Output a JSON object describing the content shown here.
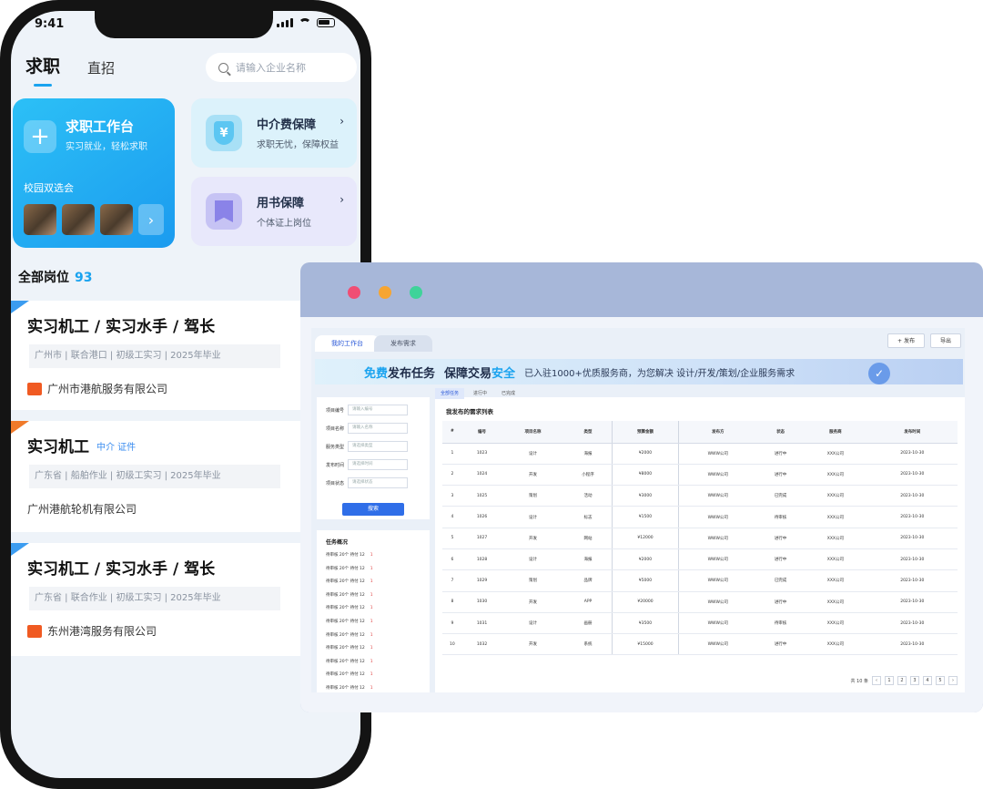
{
  "phone": {
    "status_time": "9:41",
    "tabs": {
      "active": "求职",
      "other": "直招"
    },
    "search_placeholder": "请输入企业名称",
    "main_card": {
      "title": "求职工作台",
      "subtitle": "实习就业，轻松求职",
      "label": "校园双选会",
      "more": "›"
    },
    "side_cards": [
      {
        "title": "中介费保障",
        "arrow": "›",
        "subtitle": "求职无忧，保障权益",
        "icon": "shield-icon"
      },
      {
        "title": "用书保障",
        "arrow": "›",
        "subtitle": "个体证上岗位",
        "icon": "bookmark-icon"
      }
    ],
    "all_positions": {
      "label": "全部岗位",
      "count": "93"
    },
    "jobs": [
      {
        "title": "实习机工 / 实习水手 / 驾长",
        "tag": "",
        "meta": "广州市 | 联合港口 | 初级工实习 | 2025年毕业",
        "company": "广州市港航服务有限公司",
        "corner_color": "#3b9cf0",
        "logo_color": "#f05a22"
      },
      {
        "title": "实习机工",
        "tag": "中介  证件",
        "meta": "广东省 | 船舶作业 | 初级工实习 | 2025年毕业",
        "company": "广州港航轮机有限公司",
        "corner_color": "#f07a2a",
        "logo_color": ""
      },
      {
        "title": "实习机工 / 实习水手 / 驾长",
        "tag": "",
        "meta": "广东省 | 联合作业 | 初级工实习 | 2025年毕业",
        "company": "东州港湾服务有限公司",
        "corner_color": "#3b9cf0",
        "logo_color": "#f05a22"
      }
    ]
  },
  "window": {
    "dot_colors": [
      "#f04e74",
      "#f7a531",
      "#3fd39a"
    ],
    "tabs": [
      "我的工作台",
      "发布需求"
    ],
    "buttons": [
      "+ 发布",
      "导出"
    ],
    "banner": {
      "part1": "免费",
      "part2": "发布任务",
      "part3": "保障交易",
      "part4": "安全",
      "rest": "已入驻1000+优质服务商，为您解决 设计/开发/策划/企业服务需求",
      "check": "✓"
    },
    "filters": [
      {
        "label": "项目编号",
        "placeholder": "请输入编号"
      },
      {
        "label": "项目名称",
        "placeholder": "请输入名称"
      },
      {
        "label": "服务类型",
        "placeholder": "请选择类型"
      },
      {
        "label": "发布时间",
        "placeholder": "请选择时间"
      },
      {
        "label": "项目状态",
        "placeholder": "请选择状态"
      }
    ],
    "search_button": "搜索",
    "stats_title": "任务概况",
    "stats_rows": [
      {
        "text": "待审核 20个  待付 12",
        "badge": "1"
      },
      {
        "text": "待审核 20个  待付 12",
        "badge": "1"
      },
      {
        "text": "待审核 20个  待付 12",
        "badge": "1"
      },
      {
        "text": "待审核 20个  待付 12",
        "badge": "1"
      },
      {
        "text": "待审核 20个  待付 12",
        "badge": "1"
      },
      {
        "text": "待审核 20个  待付 12",
        "badge": "1"
      },
      {
        "text": "待审核 20个  待付 12",
        "badge": "1"
      },
      {
        "text": "待审核 20个  待付 12",
        "badge": "1"
      },
      {
        "text": "待审核 20个  待付 12",
        "badge": "1"
      },
      {
        "text": "待审核 20个  待付 12",
        "badge": "1"
      },
      {
        "text": "待审核 20个  待付 12",
        "badge": "1"
      }
    ],
    "table_tabs": [
      "全部任务",
      "进行中",
      "已完成"
    ],
    "table_title": "我发布的需求列表",
    "columns": [
      "#",
      "编号",
      "项目名称",
      "类型",
      "预算金额",
      "发布方",
      "状态",
      "服务商",
      "发布时间"
    ],
    "rows": [
      [
        "1",
        "1023",
        "设计",
        "海报",
        "¥2000",
        "WWW公司",
        "进行中",
        "XXX公司",
        "2023-10-30"
      ],
      [
        "2",
        "1024",
        "开发",
        "小程序",
        "¥8000",
        "WWW公司",
        "进行中",
        "XXX公司",
        "2023-10-30"
      ],
      [
        "3",
        "1025",
        "策划",
        "活动",
        "¥3000",
        "WWW公司",
        "已完成",
        "XXX公司",
        "2023-10-30"
      ],
      [
        "4",
        "1026",
        "设计",
        "标志",
        "¥1500",
        "WWW公司",
        "待审核",
        "XXX公司",
        "2023-10-30"
      ],
      [
        "5",
        "1027",
        "开发",
        "网站",
        "¥12000",
        "WWW公司",
        "进行中",
        "XXX公司",
        "2023-10-30"
      ],
      [
        "6",
        "1028",
        "设计",
        "海报",
        "¥2000",
        "WWW公司",
        "进行中",
        "XXX公司",
        "2023-10-30"
      ],
      [
        "7",
        "1029",
        "策划",
        "品牌",
        "¥5000",
        "WWW公司",
        "已完成",
        "XXX公司",
        "2023-10-30"
      ],
      [
        "8",
        "1030",
        "开发",
        "APP",
        "¥20000",
        "WWW公司",
        "进行中",
        "XXX公司",
        "2023-10-30"
      ],
      [
        "9",
        "1031",
        "设计",
        "画册",
        "¥3500",
        "WWW公司",
        "待审核",
        "XXX公司",
        "2023-10-30"
      ],
      [
        "10",
        "1032",
        "开发",
        "系统",
        "¥15000",
        "WWW公司",
        "进行中",
        "XXX公司",
        "2023-10-30"
      ]
    ],
    "pager": {
      "total": "共 10 条",
      "pages": [
        "‹",
        "1",
        "2",
        "3",
        "4",
        "5",
        "›"
      ]
    }
  }
}
